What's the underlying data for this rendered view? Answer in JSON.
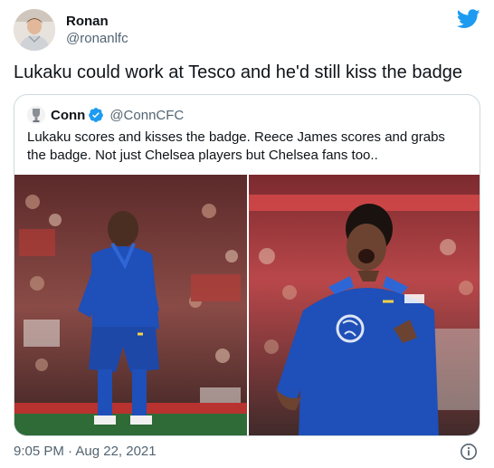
{
  "tweet": {
    "author_name": "Ronan",
    "author_handle": "@ronanlfc",
    "text": "Lukaku could work at Tesco and he'd still kiss the badge",
    "timestamp": "9:05 PM · Aug 22, 2021"
  },
  "quoted": {
    "author_name": "Conn",
    "author_handle": "@ConnCFC",
    "text": "Lukaku scores and kisses the badge. Reece James scores and grabs the badge. Not just Chelsea players but Chelsea fans too..",
    "verified": true
  },
  "icons": {
    "platform": "twitter-bird-icon",
    "verified": "verified-badge-icon",
    "info": "info-icon"
  },
  "colors": {
    "accent": "#1d9bf0",
    "text_primary": "#0f1419",
    "text_secondary": "#536471",
    "border": "#cfd9de"
  }
}
